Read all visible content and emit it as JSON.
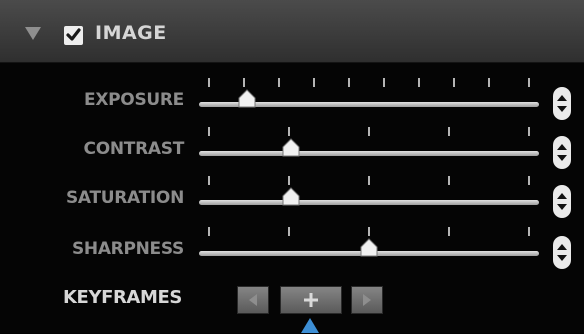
{
  "section": {
    "title": "IMAGE",
    "enabled": true,
    "expanded": true,
    "icons": {
      "collapse": "triangle-down-icon",
      "checkbox": "checkmark-icon"
    }
  },
  "sliders": [
    {
      "id": "exposure",
      "label": "EXPOSURE",
      "position": 0.14
    },
    {
      "id": "contrast",
      "label": "CONTRAST",
      "position": 0.27
    },
    {
      "id": "saturation",
      "label": "SATURATION",
      "position": 0.27
    },
    {
      "id": "sharpness",
      "label": "SHARPNESS",
      "position": 0.5
    }
  ],
  "keyframes": {
    "label": "KEYFRAMES",
    "buttons": [
      {
        "id": "prev",
        "icon": "previous-keyframe-icon",
        "enabled": false
      },
      {
        "id": "add",
        "icon": "plus-icon",
        "enabled": true
      },
      {
        "id": "next",
        "icon": "next-keyframe-icon",
        "enabled": false
      }
    ]
  },
  "colors": {
    "panel_bg": "#050505",
    "header_bg": "#3d3d3d",
    "label": "#8c8c8c",
    "header_text": "#d6d6d6",
    "track": "#cccccc",
    "cursor": "#3d8fd6"
  }
}
